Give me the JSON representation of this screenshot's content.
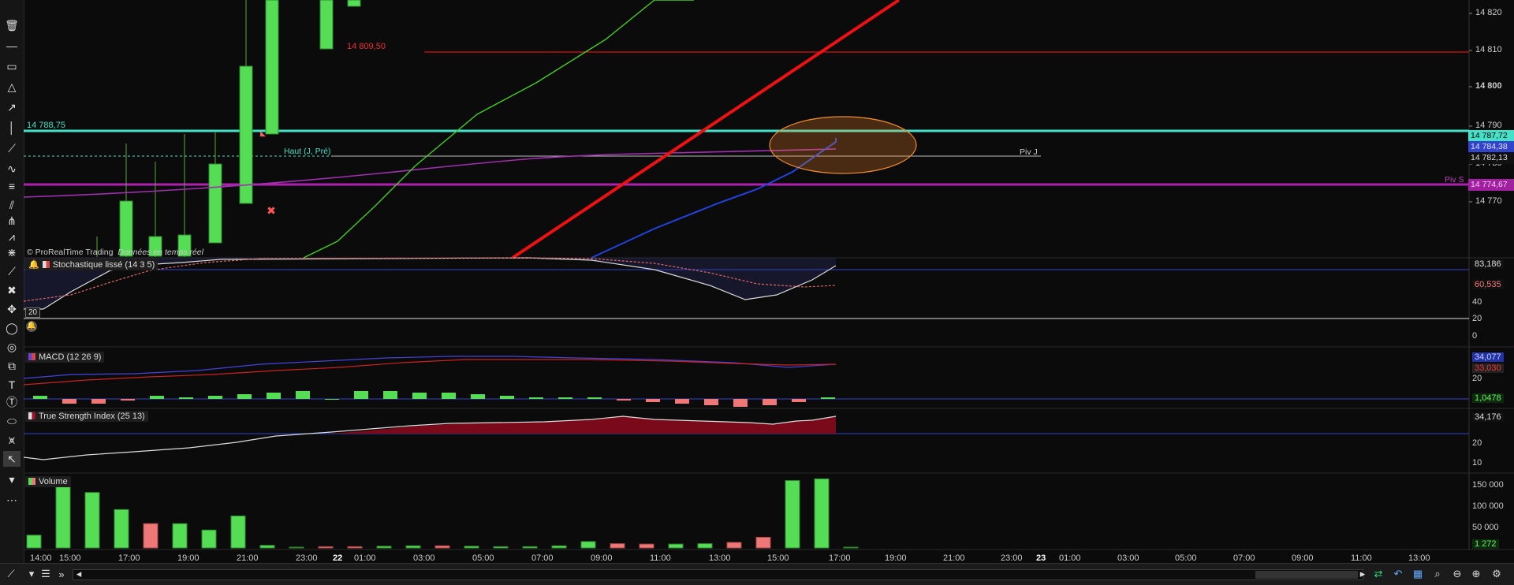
{
  "toolbar": {
    "tools": [
      {
        "name": "trash-icon",
        "glyph": "🗑"
      },
      {
        "name": "horizontal-line-icon",
        "glyph": "—"
      },
      {
        "name": "rectangle-icon",
        "glyph": "▭"
      },
      {
        "name": "triangle-icon",
        "glyph": "△"
      },
      {
        "name": "arrow-icon",
        "glyph": "↗"
      },
      {
        "name": "vertical-line-icon",
        "glyph": "│"
      },
      {
        "name": "trend-line-icon",
        "glyph": "⟋"
      },
      {
        "name": "zigzag-icon",
        "glyph": "∿"
      },
      {
        "name": "fibonacci-icon",
        "glyph": "≡"
      },
      {
        "name": "channel-icon",
        "glyph": "⫽"
      },
      {
        "name": "pitchfork-icon",
        "glyph": "⋔"
      },
      {
        "name": "gann-icon",
        "glyph": "⩘"
      },
      {
        "name": "fib-fan-icon",
        "glyph": "⋇"
      },
      {
        "name": "regression-icon",
        "glyph": "⟋"
      },
      {
        "name": "tools-icon",
        "glyph": "✖"
      },
      {
        "name": "move-icon",
        "glyph": "✥"
      },
      {
        "name": "ellipse-icon",
        "glyph": "◯"
      },
      {
        "name": "spiral-icon",
        "glyph": "◎"
      },
      {
        "name": "copy-icon",
        "glyph": "⧉"
      },
      {
        "name": "text-icon",
        "glyph": "T"
      },
      {
        "name": "text-circle-icon",
        "glyph": "Ⓣ"
      },
      {
        "name": "oval-icon",
        "glyph": "⬭"
      },
      {
        "name": "wave-icon",
        "glyph": "⩙"
      },
      {
        "name": "cursor-icon",
        "glyph": "↖"
      },
      {
        "name": "more-icon",
        "glyph": "▾"
      },
      {
        "name": "dots-icon",
        "glyph": "⋯"
      }
    ]
  },
  "price_panel": {
    "watermark": "© ProRealTime Trading",
    "watermark_sub": "Données en temps réel",
    "level_left": "14 788,75",
    "level_red": "14 809,50",
    "haut_label": "Haut (J, Pré)",
    "piv_j_label": "Piv J",
    "piv_s_label": "Piv S",
    "axis_ticks": [
      "14 820",
      "14 810",
      "14 800",
      "14 790",
      "14 780",
      "14 770"
    ],
    "price_boxes": [
      {
        "text": "14 787,72",
        "bg": "#45e0c8",
        "fg": "#000000"
      },
      {
        "text": "14 784,38",
        "bg": "#3344cc",
        "fg": "#e0e0ff"
      },
      {
        "text": "14 782,13",
        "bg": "#111111",
        "fg": "#dddddd"
      },
      {
        "text": "14 774,67",
        "bg": "#a020a0",
        "fg": "#ffccff"
      }
    ]
  },
  "stochastic": {
    "label": "Stochastique lissé (14 3 5)",
    "level_20": "20",
    "values": [
      "83,186",
      "60,535"
    ],
    "ticks": [
      "40",
      "20",
      "0"
    ]
  },
  "macd": {
    "label": "MACD (12 26 9)",
    "values": [
      "34,077",
      "33,030",
      "1,0478"
    ],
    "ticks": [
      "20"
    ]
  },
  "tsi": {
    "label": "True Strength Index (25 13)",
    "values": [
      "34,176"
    ],
    "ticks": [
      "20",
      "10"
    ]
  },
  "volume": {
    "label": "Volume",
    "values": [
      "1 272"
    ],
    "ticks": [
      "150 000",
      "100 000",
      "50 000"
    ],
    "bars": [
      {
        "v": 30000,
        "up": true
      },
      {
        "v": 145000,
        "up": true
      },
      {
        "v": 130000,
        "up": true
      },
      {
        "v": 90000,
        "up": true
      },
      {
        "v": 57000,
        "up": false
      },
      {
        "v": 57000,
        "up": true
      },
      {
        "v": 42000,
        "up": true
      },
      {
        "v": 75000,
        "up": true
      },
      {
        "v": 6000,
        "up": true
      },
      {
        "v": 1500,
        "up": true
      },
      {
        "v": 3000,
        "up": false
      },
      {
        "v": 3000,
        "up": false
      },
      {
        "v": 4000,
        "up": true
      },
      {
        "v": 5000,
        "up": true
      },
      {
        "v": 5000,
        "up": false
      },
      {
        "v": 4000,
        "up": true
      },
      {
        "v": 3000,
        "up": true
      },
      {
        "v": 3000,
        "up": true
      },
      {
        "v": 5000,
        "up": true
      },
      {
        "v": 15000,
        "up": true
      },
      {
        "v": 10000,
        "up": false
      },
      {
        "v": 9000,
        "up": false
      },
      {
        "v": 9000,
        "up": true
      },
      {
        "v": 10000,
        "up": true
      },
      {
        "v": 13000,
        "up": false
      },
      {
        "v": 25000,
        "up": false
      },
      {
        "v": 158000,
        "up": true
      },
      {
        "v": 162000,
        "up": true
      },
      {
        "v": 1272,
        "up": true
      }
    ]
  },
  "time_axis": [
    "14:00",
    "15:00",
    "17:00",
    "19:00",
    "21:00",
    "23:00",
    "22",
    "01:00",
    "03:00",
    "05:00",
    "07:00",
    "09:00",
    "11:00",
    "13:00",
    "15:00",
    "17:00",
    "19:00",
    "21:00",
    "23:00",
    "23",
    "01:00",
    "03:00",
    "05:00",
    "07:00",
    "09:00",
    "11:00",
    "13:00"
  ],
  "bottombar": {
    "buttons": [
      {
        "name": "draw-menu-icon",
        "glyph": "⟋"
      },
      {
        "name": "dropdown-icon",
        "glyph": "▾"
      },
      {
        "name": "list-icon",
        "glyph": "☰"
      },
      {
        "name": "fast-forward-icon",
        "glyph": "»"
      },
      {
        "name": "scroll-left-icon",
        "glyph": "◂"
      },
      {
        "name": "scroll-right-icon",
        "glyph": "▸"
      },
      {
        "name": "sync-arrows-icon",
        "glyph": "⇄"
      },
      {
        "name": "undo-icon",
        "glyph": "↶"
      },
      {
        "name": "calendar-icon",
        "glyph": "▦"
      },
      {
        "name": "zoom-tool-icon",
        "glyph": "⌕"
      },
      {
        "name": "zoom-out-icon",
        "glyph": "⊖"
      },
      {
        "name": "zoom-in-icon",
        "glyph": "⊕"
      },
      {
        "name": "zoom-settings-icon",
        "glyph": "⚙"
      }
    ]
  },
  "colors": {
    "up": "#55dd55",
    "down": "#ee7777",
    "cyan": "#45e0c8",
    "magenta": "#b020b0",
    "red": "#e01010",
    "blue": "#2244dd",
    "green_line": "#44cc22"
  }
}
